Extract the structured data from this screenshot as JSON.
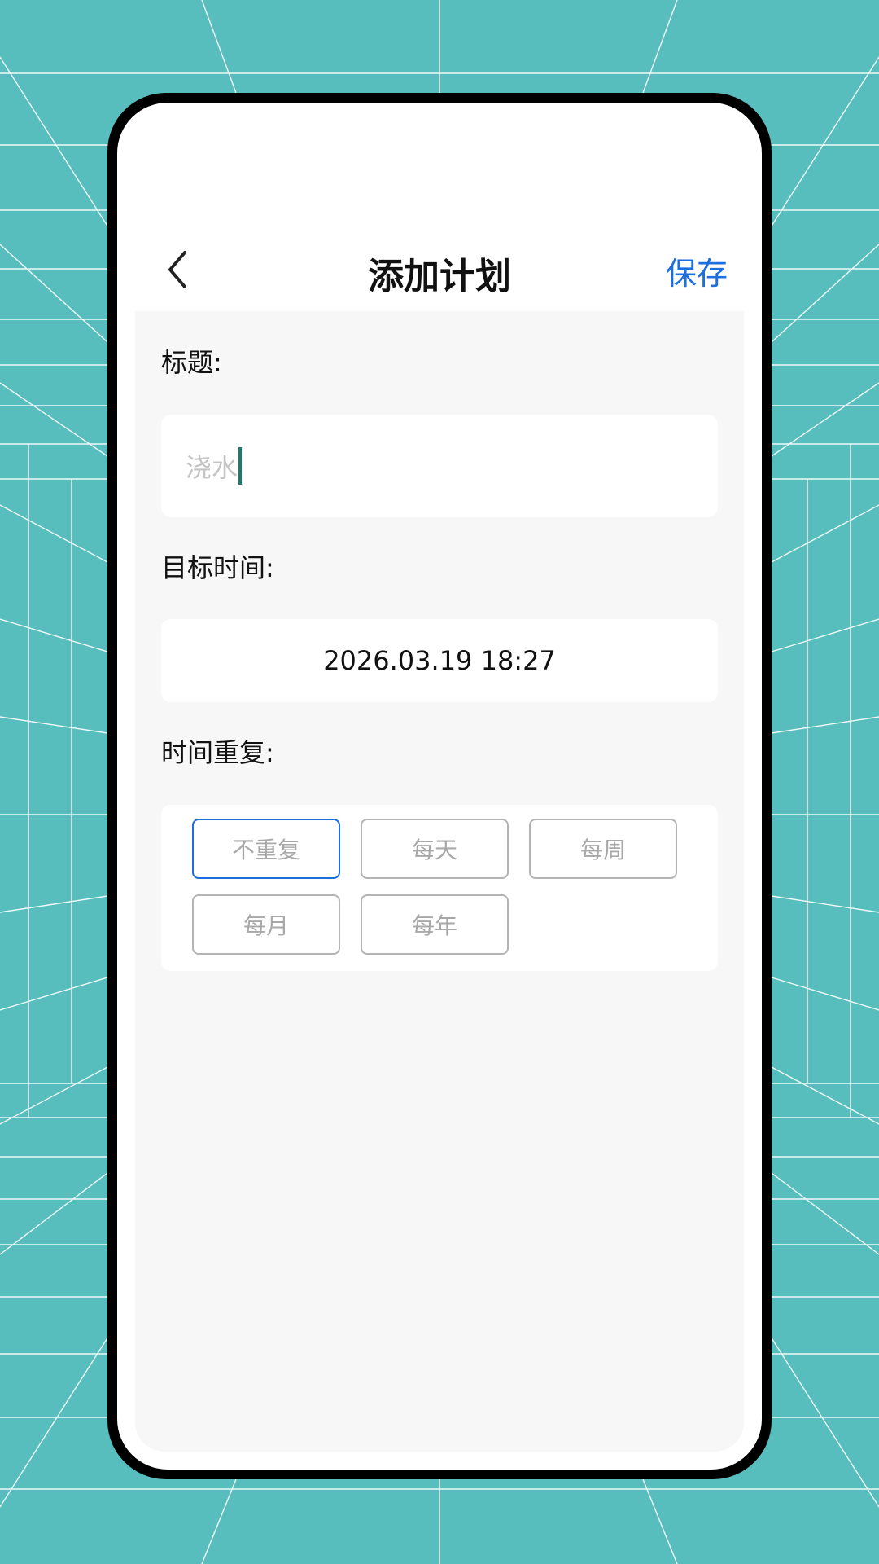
{
  "theme": {
    "accent": "#1c6fe0",
    "background": "#58bdbd",
    "caret": "#1f7a6e"
  },
  "header": {
    "back_icon": "chevron-left-icon",
    "title": "添加计划",
    "save_label": "保存"
  },
  "form": {
    "title_label": "标题:",
    "title_value": "浇水",
    "time_label": "目标时间:",
    "time_value": "2026.03.19 18:27",
    "repeat_label": "时间重复:",
    "repeat_options": [
      {
        "label": "不重复",
        "selected": true
      },
      {
        "label": "每天",
        "selected": false
      },
      {
        "label": "每周",
        "selected": false
      },
      {
        "label": "每月",
        "selected": false
      },
      {
        "label": "每年",
        "selected": false
      }
    ]
  }
}
